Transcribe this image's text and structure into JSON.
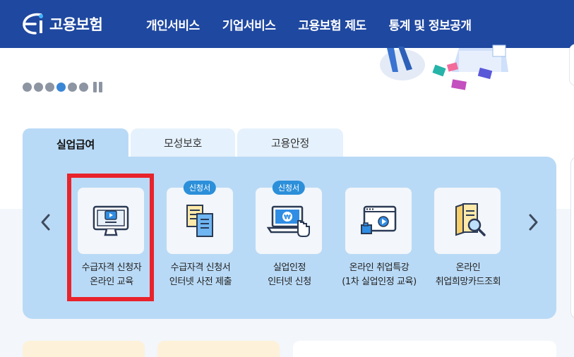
{
  "header": {
    "logo_text": "고용보험",
    "nav": [
      "개인서비스",
      "기업서비스",
      "고용보험 제도",
      "통계 및 정보공개"
    ]
  },
  "hero": {
    "slide_count": 6,
    "active_slide": 4
  },
  "tabs": [
    {
      "label": "실업급여",
      "active": true
    },
    {
      "label": "모성보호",
      "active": false
    },
    {
      "label": "고용안정",
      "active": false
    }
  ],
  "services": [
    {
      "label": "수급자격 신청자\n온라인 교육",
      "badge": "",
      "icon": "monitor-play-icon"
    },
    {
      "label": "수급자격 신청서\n인터넷 사전 제출",
      "badge": "신청서",
      "icon": "documents-icon"
    },
    {
      "label": "실업인정\n인터넷 신청",
      "badge": "신청서",
      "icon": "laptop-won-click-icon"
    },
    {
      "label": "온라인 취업특강\n(1차 실업인정 교육)",
      "badge": "",
      "icon": "browser-video-icon"
    },
    {
      "label": "온라인\n취업희망카드조회",
      "badge": "",
      "icon": "card-search-icon"
    }
  ],
  "colors": {
    "header": "#1f48a0",
    "panel": "#b9daf6",
    "highlight": "#e8232b",
    "badge": "#2c8fd9"
  }
}
